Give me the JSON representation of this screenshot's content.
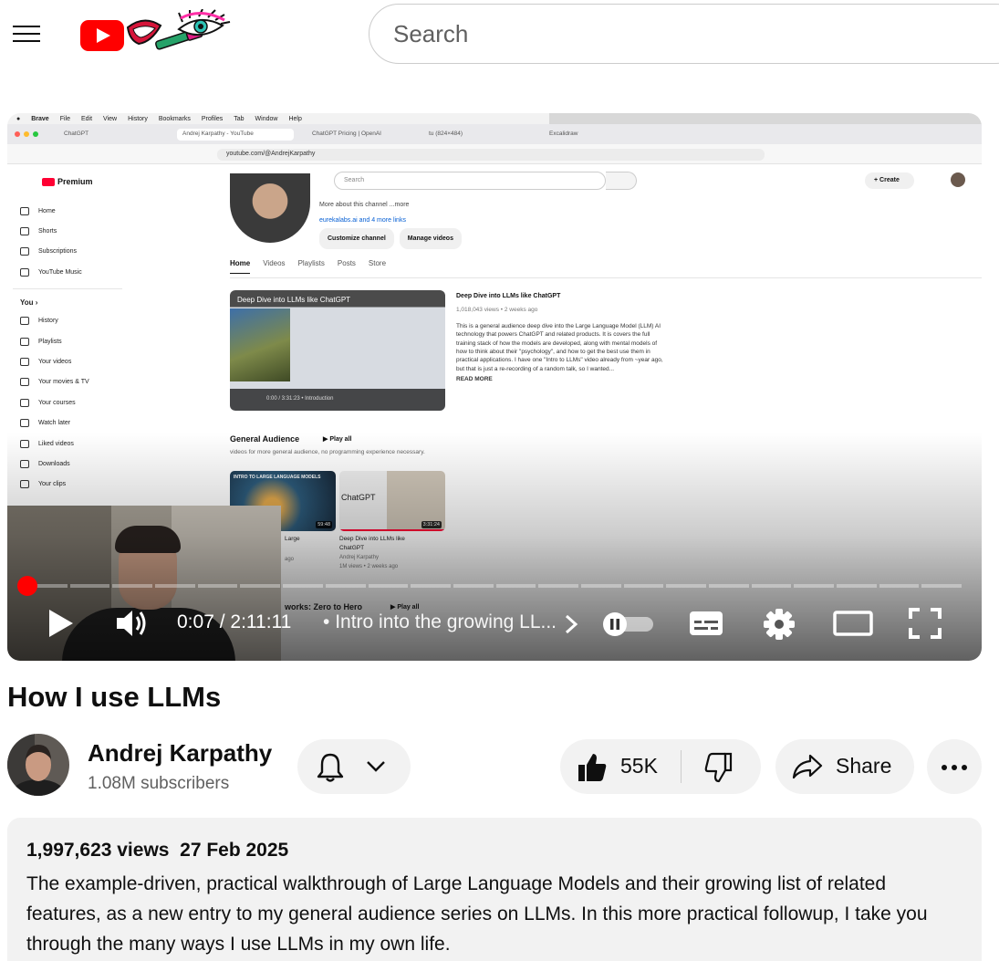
{
  "search": {
    "placeholder": "Search"
  },
  "colors": {
    "brand": "#ff0033",
    "progress": "#ff0000",
    "link": "#065fd4"
  },
  "player": {
    "time_current": "0:07",
    "time_total": "2:11:11",
    "chapter": "Intro into the growing LL...",
    "progress_fraction": 0.0009,
    "autoplay": false,
    "icons": [
      "play-icon",
      "volume-icon",
      "chevron-right-icon",
      "autoplay-toggle",
      "subtitles-icon",
      "settings-icon",
      "theater-icon",
      "fullscreen-icon"
    ]
  },
  "recording": {
    "menubar": [
      "Brave",
      "File",
      "Edit",
      "View",
      "History",
      "Bookmarks",
      "Profiles",
      "Tab",
      "Window",
      "Help"
    ],
    "tabs": [
      "ChatGPT",
      "Andrej Karpathy - YouTube",
      "ChatGPT Pricing | OpenAI",
      "tu (824×484)",
      "Excalidraw"
    ],
    "url": "youtube.com/@AndrejKarpathy",
    "logo": "Premium",
    "search_placeholder": "Search",
    "create": "Create",
    "sidebar": {
      "top": [
        "Home",
        "Shorts",
        "Subscriptions",
        "YouTube Music"
      ],
      "you_label": "You",
      "you": [
        "History",
        "Playlists",
        "Your videos",
        "Your movies & TV",
        "Your courses",
        "Watch later",
        "Liked videos",
        "Downloads",
        "Your clips"
      ]
    },
    "channel": {
      "more_about": "More about this channel ...more",
      "links": "eurekalabs.ai and 4 more links",
      "customize": "Customize channel",
      "manage": "Manage videos",
      "tabs": [
        "Home",
        "Videos",
        "Playlists",
        "Posts",
        "Store"
      ]
    },
    "featured": {
      "thumb_title": "Deep Dive into LLMs like ChatGPT",
      "thumb_time": "0:00 / 3:31:23 • Introduction",
      "title": "Deep Dive into LLMs like ChatGPT",
      "meta": "1,018,043 views • 2 weeks ago",
      "desc": "This is a general audience deep dive into the Large Language Model (LLM) AI technology that powers ChatGPT and related products. It is covers the full training stack of how the models are developed, along with mental models of how to think about their \"psychology\", and how to get the best use them in practical applications. I have one \"Intro to LLMs\" video already from ~year ago, but that is just a re-recording of a random talk, so I wanted...",
      "read_more": "READ MORE"
    },
    "section": {
      "title": "General Audience",
      "play_all": "Play all",
      "subtitle": "videos for more general audience, no programming experience necessary.",
      "videos": [
        {
          "thumb_caption": "INTRO TO LARGE LANGUAGE MODELS",
          "duration": "59:48",
          "title": "Large",
          "meta": "ago"
        },
        {
          "thumb_caption": "ChatGPT",
          "duration": "3:31:24",
          "title": "Deep Dive into LLMs like ChatGPT",
          "channel": "Andrej Karpathy",
          "meta": "1M views • 2 weeks ago"
        }
      ]
    },
    "section2": {
      "title": "works: Zero to Hero",
      "play_all": "Play all"
    }
  },
  "video": {
    "title": "How I use LLMs",
    "channel_name": "Andrej Karpathy",
    "subscribers": "1.08M subscribers",
    "likes": "55K",
    "share": "Share",
    "views": "1,997,623 views",
    "date": "27 Feb 2025",
    "description": "The example-driven, practical walkthrough of Large Language Models and their growing list of related features, as a new entry to my general audience series on LLMs. In this more practical followup, I take you through the many ways I use LLMs in my own life."
  }
}
